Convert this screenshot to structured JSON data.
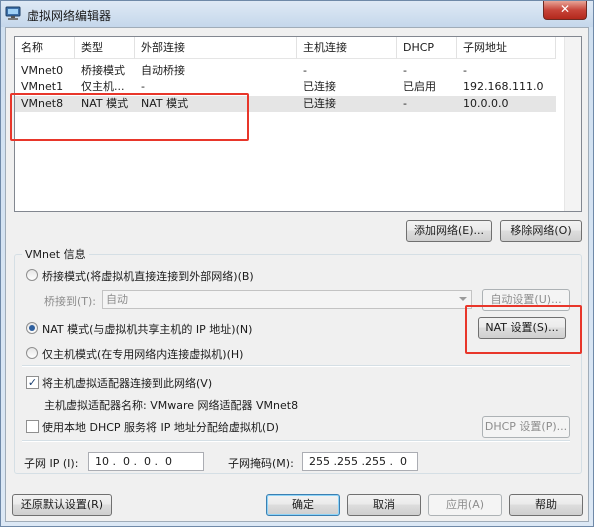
{
  "window": {
    "title": "虚拟网络编辑器",
    "close_label": "✕",
    "icon": "network-editor-icon"
  },
  "table": {
    "columns": [
      "名称",
      "类型",
      "外部连接",
      "主机连接",
      "DHCP",
      "子网地址"
    ],
    "rows": [
      {
        "name": "VMnet0",
        "type": "桥接模式",
        "external": "自动桥接",
        "host": "-",
        "dhcp": "-",
        "subnet": "-"
      },
      {
        "name": "VMnet1",
        "type": "仅主机...",
        "external": "-",
        "host": "已连接",
        "dhcp": "已启用",
        "subnet": "192.168.111.0"
      },
      {
        "name": "VMnet8",
        "type": "NAT 模式",
        "external": "NAT 模式",
        "host": "已连接",
        "dhcp": "-",
        "subnet": "10.0.0.0"
      }
    ],
    "selected_row": "VMnet8"
  },
  "buttons": {
    "add_network": "添加网络(E)...",
    "remove_network": "移除网络(O)",
    "auto_settings": "自动设置(U)...",
    "nat_settings": "NAT 设置(S)...",
    "dhcp_settings": "DHCP 设置(P)...",
    "restore_defaults": "还原默认设置(R)",
    "ok": "确定",
    "cancel": "取消",
    "apply": "应用(A)",
    "help": "帮助"
  },
  "vmnet_info": {
    "legend": "VMnet 信息",
    "bridge_mode": "桥接模式(将虚拟机直接连接到外部网络)(B)",
    "bridge_to_label": "桥接到(T):",
    "bridge_to_value": "自动",
    "nat_mode": "NAT 模式(与虚拟机共享主机的 IP 地址)(N)",
    "host_only_mode": "仅主机模式(在专用网络内连接虚拟机)(H)",
    "selected_mode": "nat",
    "connect_adapter": "将主机虚拟适配器连接到此网络(V)",
    "connect_adapter_checked": true,
    "adapter_name_label": "主机虚拟适配器名称: VMware 网络适配器 VMnet8",
    "use_dhcp": "使用本地 DHCP 服务将 IP 地址分配给虚拟机(D)",
    "use_dhcp_checked": false,
    "subnet_ip_label": "子网 IP (I):",
    "subnet_ip_value": "10 .  0 .  0 .  0",
    "subnet_mask_label": "子网掩码(M):",
    "subnet_mask_value": "255 .255 .255 .  0"
  },
  "colors": {
    "annotation_red": "#e8362a",
    "selected_row_bg": "#e5e5e5"
  }
}
